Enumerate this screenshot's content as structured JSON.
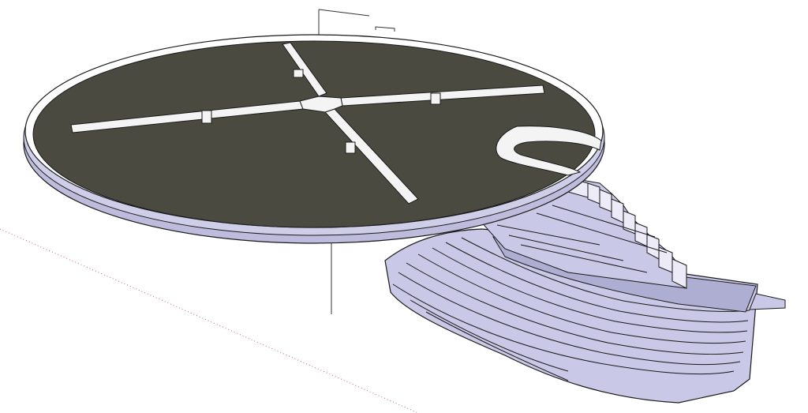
{
  "viewport": {
    "background": "#ffffff",
    "model": {
      "saucer_top_color": "#4b4a41",
      "saucer_rim_color": "#bdbcdc",
      "rail_color": "#f4f4f4",
      "hull_color": "#c9c8e6",
      "hull_shadow_color": "#aeaed2",
      "edge_color": "#1a1a1a"
    },
    "axes": {
      "red_axis": "red-axis-dotted",
      "green_axis": "green-axis-solid"
    }
  }
}
